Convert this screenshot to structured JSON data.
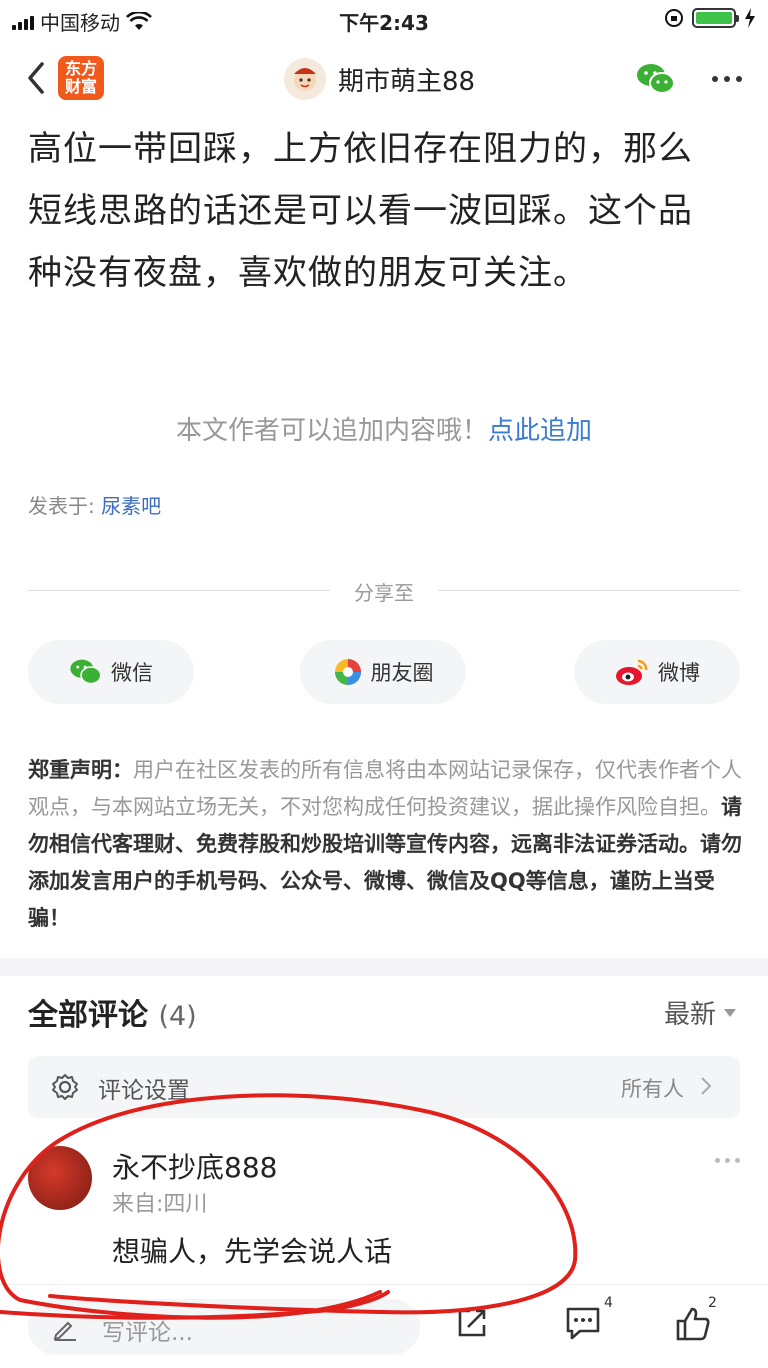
{
  "status_bar": {
    "carrier": "中国移动",
    "time": "下午2:43"
  },
  "nav": {
    "logo_text": "东方财富",
    "title": "期市萌主88"
  },
  "article": {
    "lines": [
      "高位一带回踩，上方依旧存在阻力的，那么",
      "短线思路的话还是可以看一波回踩。这个品",
      "种没有夜盘，喜欢做的朋友可关注。"
    ]
  },
  "append": {
    "prompt": "本文作者可以追加内容哦！",
    "link": "点此追加"
  },
  "published": {
    "label": "发表于:",
    "forum": "尿素吧"
  },
  "share": {
    "title": "分享至",
    "buttons": [
      {
        "label": "微信",
        "icon": "wechat-icon"
      },
      {
        "label": "朋友圈",
        "icon": "moments-icon"
      },
      {
        "label": "微博",
        "icon": "weibo-icon"
      }
    ]
  },
  "disclaimer": {
    "heading": "郑重声明：",
    "body": "用户在社区发表的所有信息将由本网站记录保存，仅代表作者个人观点，与本网站立场无关，不对您构成任何投资建议，据此操作风险自担。",
    "warning": "请勿相信代客理财、免费荐股和炒股培训等宣传内容，远离非法证券活动。请勿添加发言用户的手机号码、公众号、微博、微信及QQ等信息，谨防上当受骗！"
  },
  "comments": {
    "title": "全部评论",
    "count": "(4)",
    "sort": "最新",
    "settings_label": "评论设置",
    "settings_value": "所有人",
    "items": [
      {
        "name": "永不抄底888",
        "location": "来自:四川",
        "text": "想骗人，先学会说人话"
      }
    ]
  },
  "bottom_bar": {
    "placeholder": "写评论...",
    "comment_count": "4",
    "like_count": "2"
  },
  "colors": {
    "accent_orange": "#f25a1c",
    "link_blue": "#3a7bd5",
    "annotation_red": "#e0201b"
  }
}
